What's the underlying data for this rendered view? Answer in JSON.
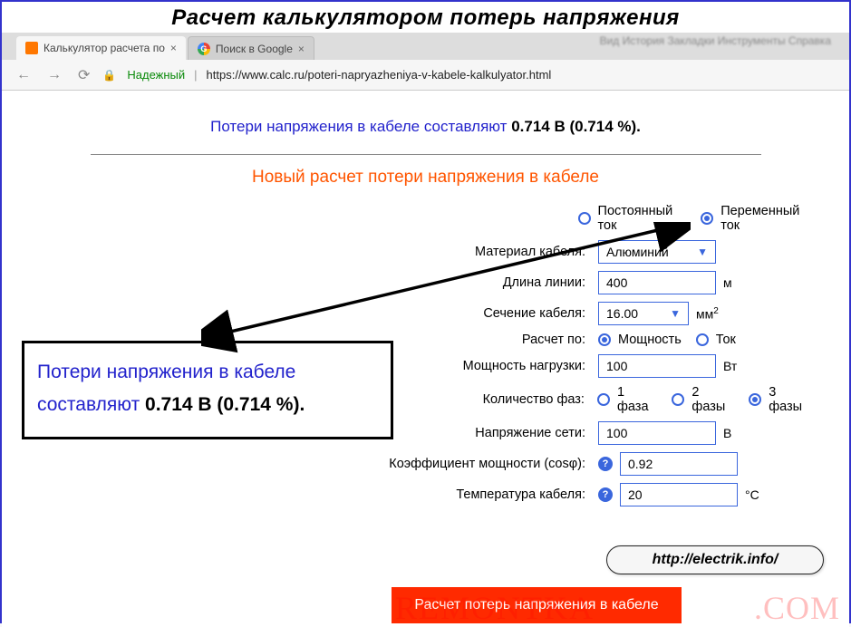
{
  "overlay_title": "Расчет калькулятором потерь напряжения",
  "tabs": [
    {
      "label": "Калькулятор расчета по",
      "active": true
    },
    {
      "label": "Поиск в Google",
      "active": false
    }
  ],
  "address": {
    "secure_label": "Надежный",
    "url": "https://www.calc.ru/poteri-napryazheniya-v-kabele-kalkulyator.html"
  },
  "result": {
    "prefix": "Потери напряжения в кабеле составляют ",
    "value": "0.714 В (0.714 %)."
  },
  "section_heading": "Новый расчет потери напряжения в кабеле",
  "form": {
    "current": {
      "dc_label": "Постоянный ток",
      "ac_label": "Переменный ток",
      "selected": "ac"
    },
    "material": {
      "label": "Материал кабеля:",
      "value": "Алюминий"
    },
    "length": {
      "label": "Длина линии:",
      "value": "400",
      "unit": "м"
    },
    "section": {
      "label": "Сечение кабеля:",
      "value": "16.00",
      "unit": "мм",
      "sup": "2"
    },
    "calc_by": {
      "label": "Расчет по:",
      "power": "Мощность",
      "current": "Ток",
      "selected": "power"
    },
    "load": {
      "label": "Мощность нагрузки:",
      "value": "100",
      "unit": "Вт"
    },
    "phases": {
      "label": "Количество фаз:",
      "p1": "1 фаза",
      "p2": "2 фазы",
      "p3": "3 фазы",
      "selected": "p3"
    },
    "voltage": {
      "label": "Напряжение сети:",
      "value": "100",
      "unit": "В"
    },
    "pf": {
      "label": "Коэффициент мощности (cosφ):",
      "value": "0.92"
    },
    "temp": {
      "label": "Температура кабеля:",
      "value": "20",
      "unit": "°C"
    }
  },
  "watermark_url": "http://electrik.info/",
  "submit_label": "Расчет потерь напряжения в кабеле",
  "wm_left": "REMONTKA",
  "wm_right": ".COM"
}
